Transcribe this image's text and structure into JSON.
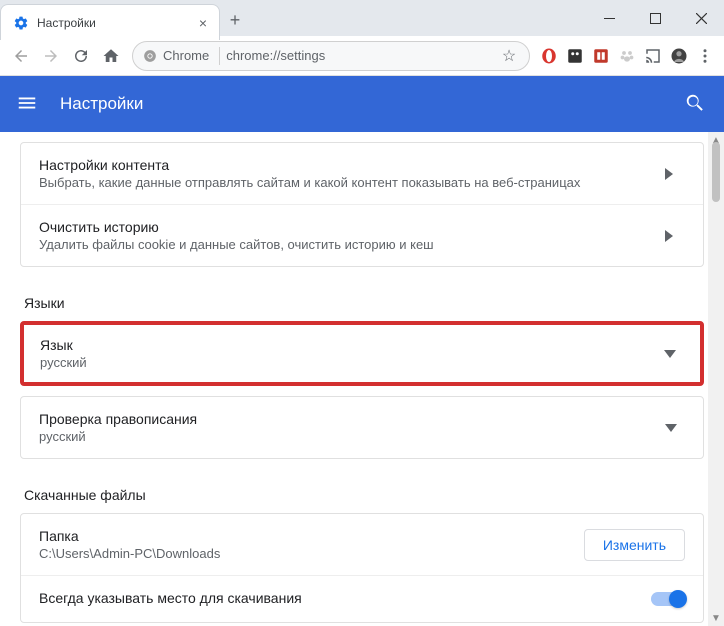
{
  "browser": {
    "tab_title": "Настройки",
    "address_chip": "Chrome",
    "address_url": "chrome://settings"
  },
  "header": {
    "title": "Настройки"
  },
  "privacy": {
    "content_title": "Настройки контента",
    "content_sub": "Выбрать, какие данные отправлять сайтам и какой контент показывать на веб-страницах",
    "clear_title": "Очистить историю",
    "clear_sub": "Удалить файлы cookie и данные сайтов, очистить историю и кеш"
  },
  "languages": {
    "section": "Языки",
    "lang_title": "Язык",
    "lang_value": "русский",
    "spell_title": "Проверка правописания",
    "spell_value": "русский"
  },
  "downloads": {
    "section": "Скачанные файлы",
    "folder_title": "Папка",
    "folder_value": "C:\\Users\\Admin-PC\\Downloads",
    "change_btn": "Изменить",
    "ask_title": "Всегда указывать место для скачивания"
  }
}
